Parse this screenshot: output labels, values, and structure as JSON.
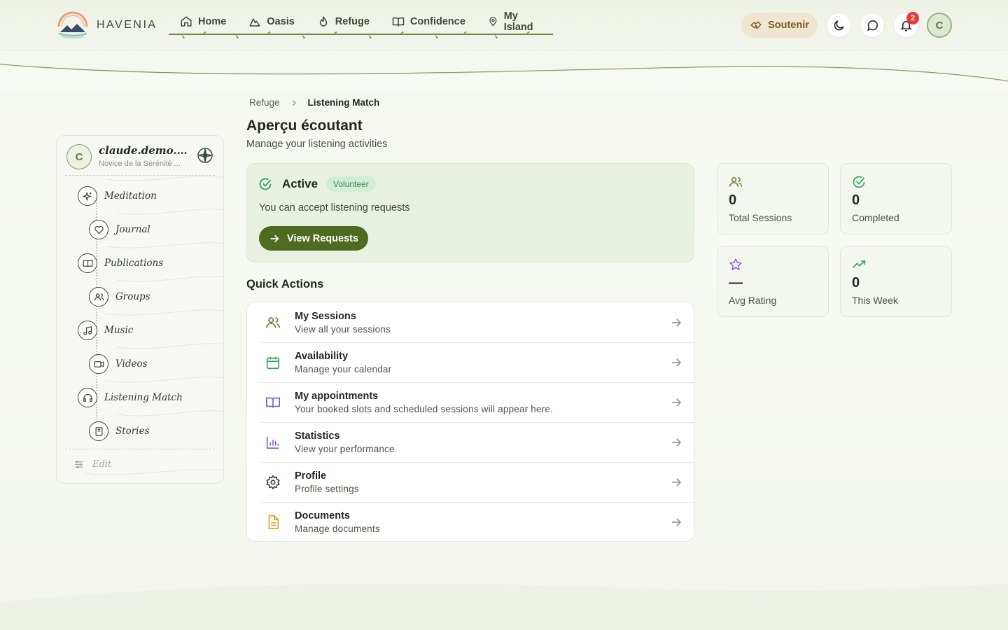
{
  "brand": {
    "name": "HAVENIA"
  },
  "nav": {
    "items": [
      {
        "label": "Home",
        "icon": "home-icon"
      },
      {
        "label": "Oasis",
        "icon": "mountain-icon"
      },
      {
        "label": "Refuge",
        "icon": "flame-icon"
      },
      {
        "label": "Confidence",
        "icon": "book-open-icon"
      },
      {
        "label": "My Island",
        "icon": "map-pin-icon"
      }
    ]
  },
  "header": {
    "support_label": "Soutenir",
    "notification_count": "2",
    "avatar_initial": "C"
  },
  "sidebar": {
    "user": {
      "initial": "C",
      "name": "claude.demo.des...",
      "subtitle": "Novice de la Sérénité ..."
    },
    "items": [
      {
        "label": "Meditation",
        "icon": "sparkles-icon"
      },
      {
        "label": "Journal",
        "icon": "heart-icon"
      },
      {
        "label": "Publications",
        "icon": "book-open-icon"
      },
      {
        "label": "Groups",
        "icon": "users-icon"
      },
      {
        "label": "Music",
        "icon": "music-icon"
      },
      {
        "label": "Videos",
        "icon": "video-icon"
      },
      {
        "label": "Listening Match",
        "icon": "headphones-icon"
      },
      {
        "label": "Stories",
        "icon": "book-icon"
      }
    ],
    "edit_label": "Edit"
  },
  "breadcrumb": {
    "parent": "Refuge",
    "current": "Listening Match"
  },
  "page": {
    "title": "Aperçu écoutant",
    "subtitle": "Manage your listening activities"
  },
  "status": {
    "title": "Active",
    "pill": "Volunteer",
    "text": "You can accept listening requests",
    "button_label": "View Requests"
  },
  "quick_actions": {
    "title": "Quick Actions",
    "items": [
      {
        "name": "My Sessions",
        "desc": "View all your sessions",
        "icon": "users-icon",
        "color": "#6b7d2a"
      },
      {
        "name": "Availability",
        "desc": "Manage your calendar",
        "icon": "calendar-icon",
        "color": "#2fa55a"
      },
      {
        "name": "My appointments",
        "desc": "Your booked slots and scheduled sessions will appear here.",
        "icon": "book-open-icon",
        "color": "#7c5cd6"
      },
      {
        "name": "Statistics",
        "desc": "View your performance",
        "icon": "bar-chart-icon",
        "color": "#8b5cd6"
      },
      {
        "name": "Profile",
        "desc": "Profile settings",
        "icon": "gear-icon",
        "color": "#3c4a38"
      },
      {
        "name": "Documents",
        "desc": "Manage documents",
        "icon": "file-text-icon",
        "color": "#e0a020"
      }
    ]
  },
  "stats": [
    {
      "value": "0",
      "label": "Total Sessions",
      "icon": "users-icon",
      "color": "#6b7d2a"
    },
    {
      "value": "0",
      "label": "Completed",
      "icon": "check-circle-icon",
      "color": "#2fa55a"
    },
    {
      "value": "—",
      "label": "Avg Rating",
      "icon": "star-icon",
      "color": "#8b5cd6"
    },
    {
      "value": "0",
      "label": "This Week",
      "icon": "trending-up-icon",
      "color": "#2fa55a"
    }
  ]
}
